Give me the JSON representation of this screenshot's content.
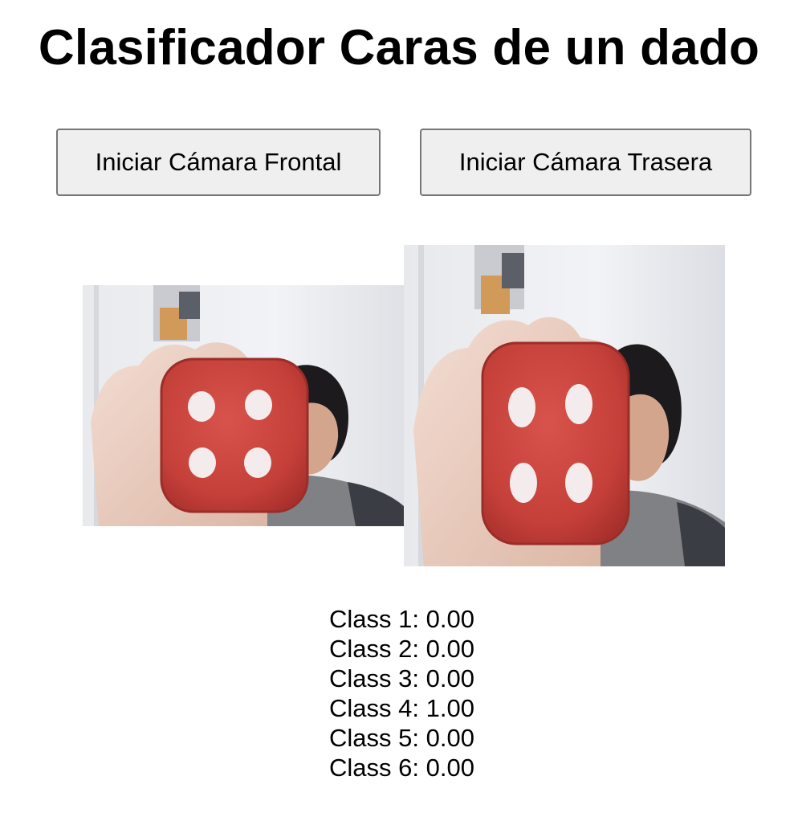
{
  "title": "Clasificador Caras de un dado",
  "buttons": {
    "front_label": "Iniciar Cámara Frontal",
    "back_label": "Iniciar Cámara Trasera"
  },
  "colors": {
    "button_bg": "#efefef",
    "button_border": "#767676",
    "die_red": "#c8423c"
  },
  "results": [
    {
      "label": "Class 1:",
      "value": "0.00"
    },
    {
      "label": "Class 2:",
      "value": "0.00"
    },
    {
      "label": "Class 3:",
      "value": "0.00"
    },
    {
      "label": "Class 4:",
      "value": "1.00"
    },
    {
      "label": "Class 5:",
      "value": "0.00"
    },
    {
      "label": "Class 6:",
      "value": "0.00"
    }
  ]
}
